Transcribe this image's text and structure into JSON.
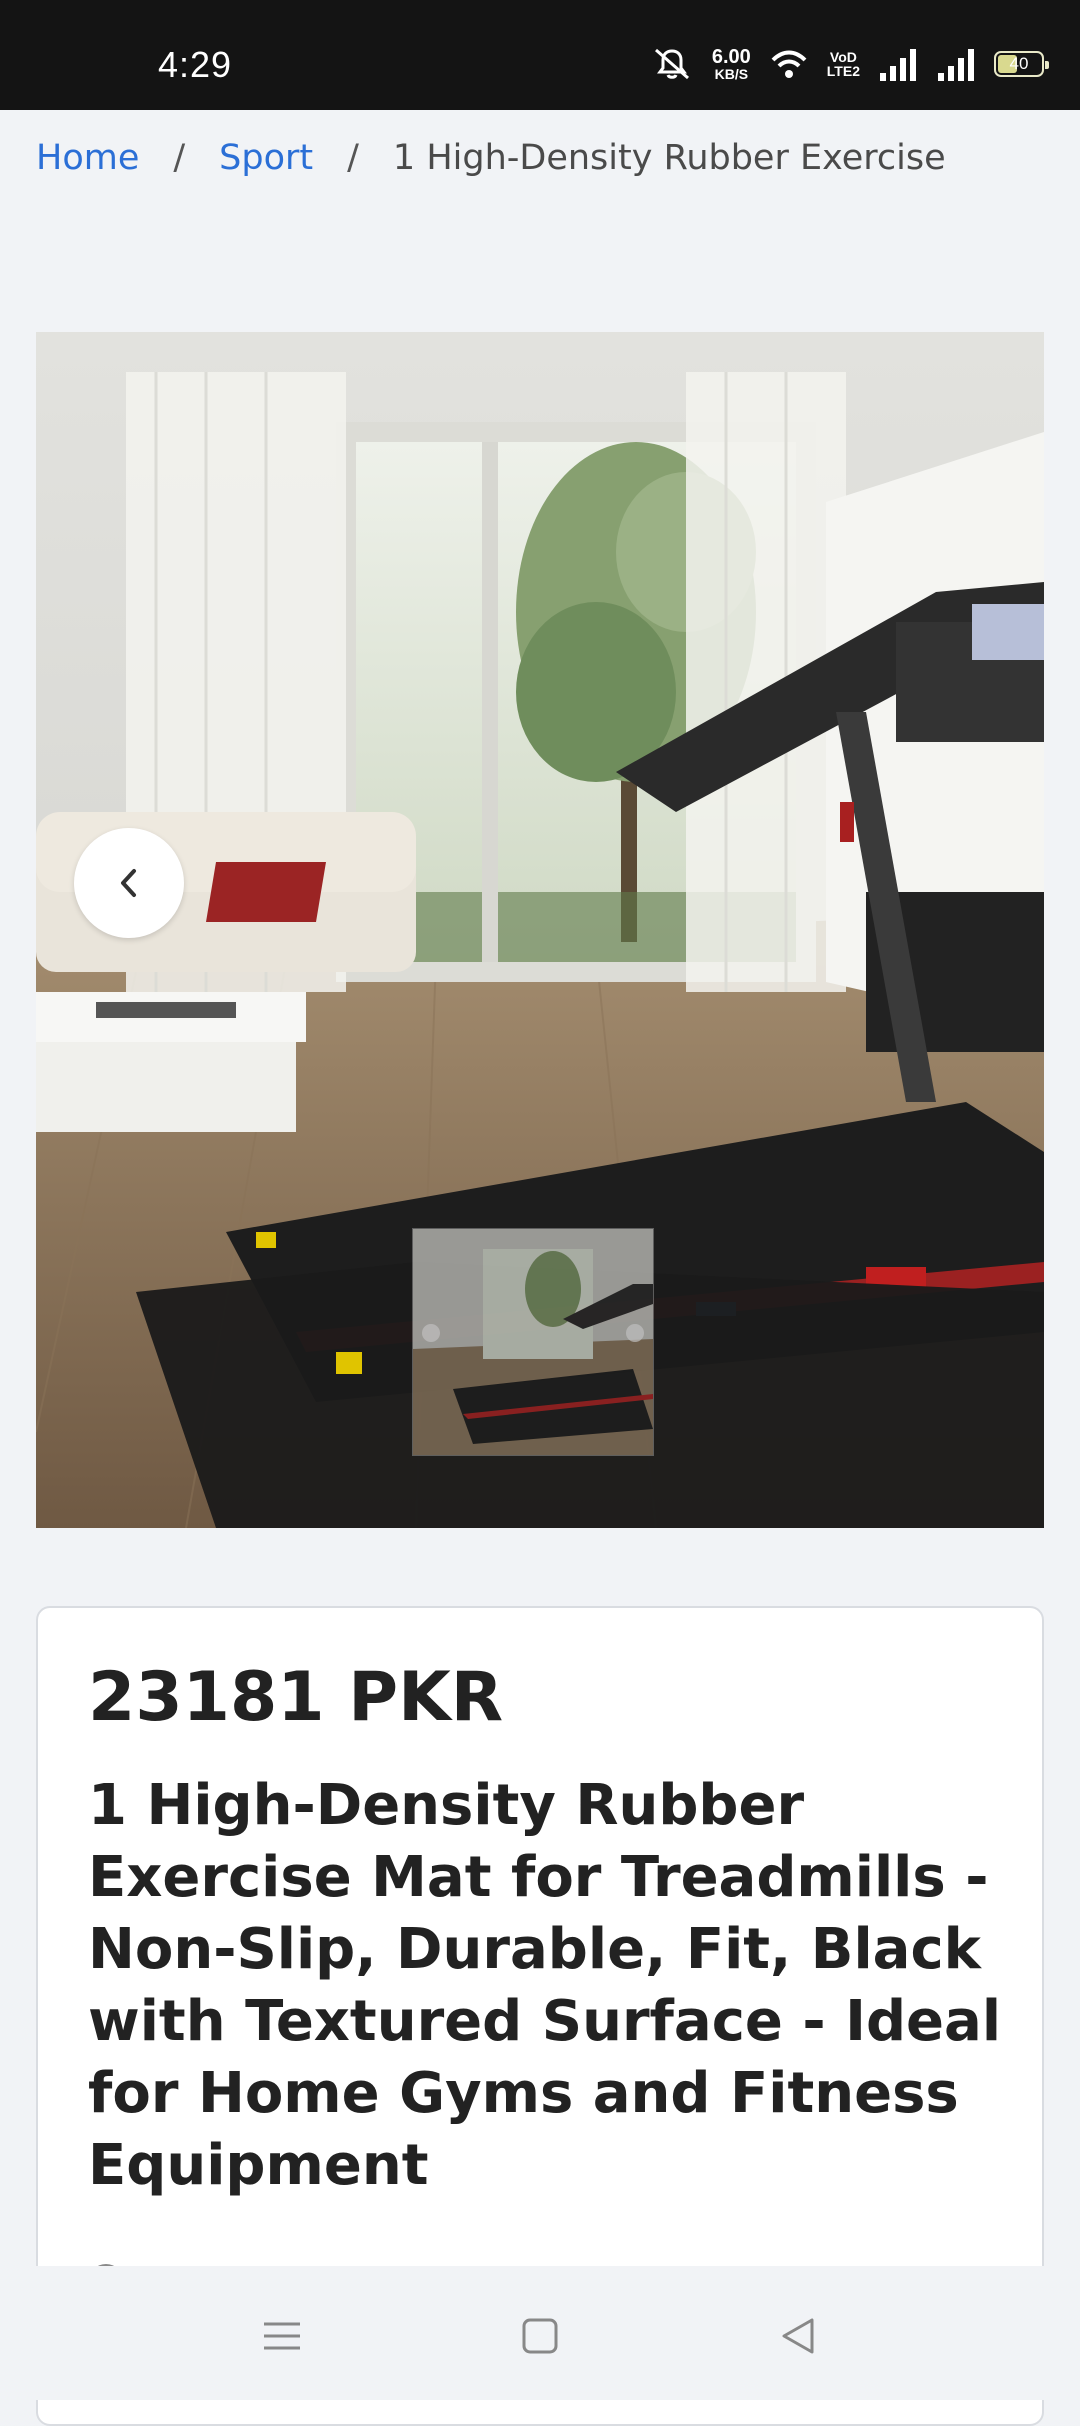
{
  "status_bar": {
    "time": "4:29",
    "net_speed_value": "6.00",
    "net_speed_unit": "KB/S",
    "volte_top": "VoD",
    "volte_bottom": "LTE2",
    "battery_level": "40",
    "icons": [
      "mute-icon",
      "wifi-icon",
      "signal-icon",
      "signal-icon",
      "battery-icon"
    ]
  },
  "breadcrumb": {
    "home": "Home",
    "separator": "/",
    "sport": "Sport",
    "current": "1 High-Density Rubber Exercise"
  },
  "gallery": {
    "prev_icon": "chevron-left-icon"
  },
  "product": {
    "price": "23181 PKR",
    "title": "1 High-Density Rubber Exercise Mat for Treadmills - Non-Slip, Durable, Fit, Black with Textured Surface - Ideal for Home Gyms and Fitness Equipment"
  },
  "nav": {
    "icons": [
      "menu-icon",
      "home-square-icon",
      "back-triangle-icon"
    ]
  },
  "colors": {
    "link": "#2b6fd6",
    "status_bar_bg": "#141414",
    "page_bg": "#f1f3f6"
  }
}
